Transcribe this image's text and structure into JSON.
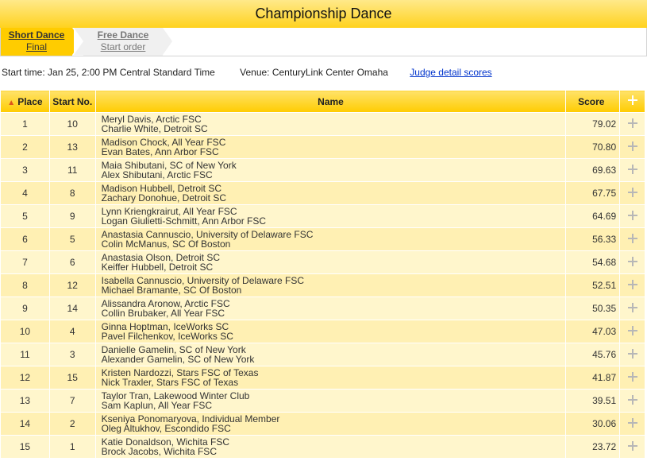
{
  "title": "Championship Dance",
  "tabs": [
    {
      "line1": "Short Dance",
      "line2": "Final"
    },
    {
      "line1": "Free Dance",
      "line2": "Start order"
    }
  ],
  "info": {
    "start_time": "Start time: Jan 25, 2:00 PM Central Standard Time",
    "venue": "Venue: CenturyLink Center Omaha",
    "judge_link": "Judge detail scores"
  },
  "table": {
    "headers": {
      "place": "Place",
      "start": "Start No.",
      "name": "Name",
      "score": "Score"
    },
    "rows": [
      {
        "place": "1",
        "start": "10",
        "name1": "Meryl Davis, Arctic FSC",
        "name2": "Charlie White, Detroit SC",
        "score": "79.02"
      },
      {
        "place": "2",
        "start": "13",
        "name1": "Madison Chock, All Year FSC",
        "name2": "Evan Bates, Ann Arbor FSC",
        "score": "70.80"
      },
      {
        "place": "3",
        "start": "11",
        "name1": "Maia Shibutani, SC of New York",
        "name2": "Alex Shibutani, Arctic FSC",
        "score": "69.63"
      },
      {
        "place": "4",
        "start": "8",
        "name1": "Madison Hubbell, Detroit SC",
        "name2": "Zachary Donohue, Detroit SC",
        "score": "67.75"
      },
      {
        "place": "5",
        "start": "9",
        "name1": "Lynn Kriengkrairut, All Year FSC",
        "name2": "Logan Giulietti-Schmitt, Ann Arbor FSC",
        "score": "64.69"
      },
      {
        "place": "6",
        "start": "5",
        "name1": "Anastasia Cannuscio, University of Delaware FSC",
        "name2": "Colin McManus, SC Of Boston",
        "score": "56.33"
      },
      {
        "place": "7",
        "start": "6",
        "name1": "Anastasia Olson, Detroit SC",
        "name2": "Keiffer Hubbell, Detroit SC",
        "score": "54.68"
      },
      {
        "place": "8",
        "start": "12",
        "name1": "Isabella Cannuscio, University of Delaware FSC",
        "name2": "Michael Bramante, SC Of Boston",
        "score": "52.51"
      },
      {
        "place": "9",
        "start": "14",
        "name1": "Alissandra Aronow, Arctic FSC",
        "name2": "Collin Brubaker, All Year FSC",
        "score": "50.35"
      },
      {
        "place": "10",
        "start": "4",
        "name1": "Ginna Hoptman, IceWorks SC",
        "name2": "Pavel Filchenkov, IceWorks SC",
        "score": "47.03"
      },
      {
        "place": "11",
        "start": "3",
        "name1": "Danielle Gamelin, SC of New York",
        "name2": "Alexander Gamelin, SC of New York",
        "score": "45.76"
      },
      {
        "place": "12",
        "start": "15",
        "name1": "Kristen Nardozzi, Stars FSC of Texas",
        "name2": "Nick Traxler, Stars FSC of Texas",
        "score": "41.87"
      },
      {
        "place": "13",
        "start": "7",
        "name1": "Taylor Tran, Lakewood Winter Club",
        "name2": "Sam Kaplun, All Year FSC",
        "score": "39.51"
      },
      {
        "place": "14",
        "start": "2",
        "name1": "Kseniya Ponomaryova, Individual Member",
        "name2": "Oleg Altukhov, Escondido FSC",
        "score": "30.06"
      },
      {
        "place": "15",
        "start": "1",
        "name1": "Katie Donaldson, Wichita FSC",
        "name2": "Brock Jacobs, Wichita FSC",
        "score": "23.72"
      }
    ]
  },
  "icons": {
    "sort": "double-chevron-up-icon",
    "expand": "plus-icon"
  },
  "colors": {
    "accent": "#ffcc00",
    "row_odd": "#fff6cc",
    "row_even": "#fff0b3",
    "link": "#0033cc"
  }
}
